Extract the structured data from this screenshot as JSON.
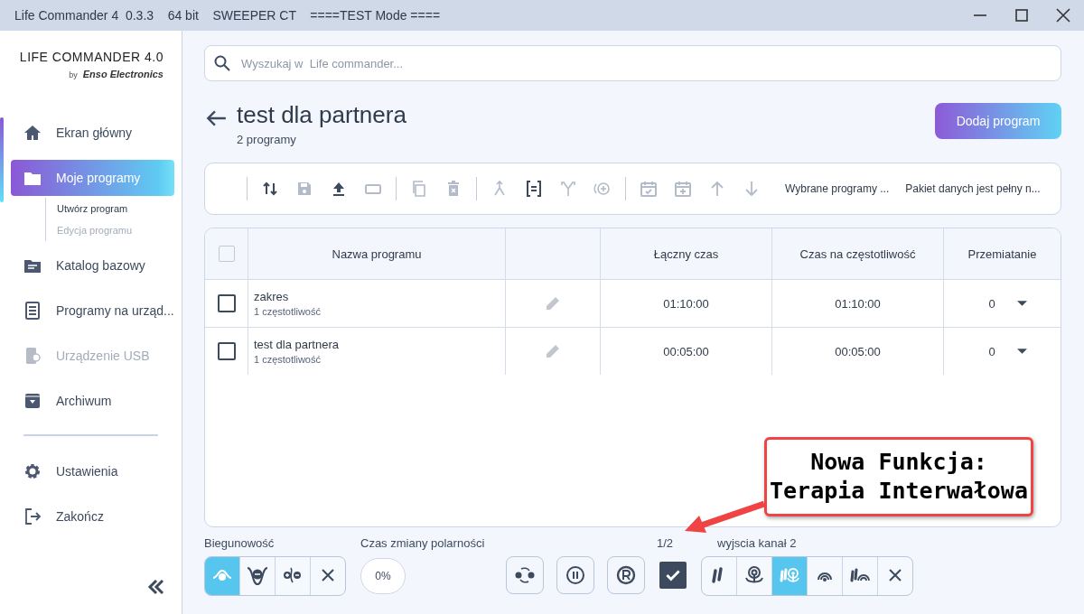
{
  "window": {
    "title": "Life Commander 4  0.3.3    64 bit    SWEEPER CT    ====TEST Mode ===="
  },
  "logo": {
    "title": "LIFE COMMANDER 4.0",
    "by": "by",
    "brand": "Enso Electronics"
  },
  "sidebar": {
    "items": [
      {
        "label": "Ekran główny",
        "selected": false,
        "disabled": false
      },
      {
        "label": "Moje programy",
        "selected": true,
        "disabled": false,
        "children": [
          {
            "label": "Utwórz program",
            "disabled": false
          },
          {
            "label": "Edycja programu",
            "disabled": true
          }
        ]
      },
      {
        "label": "Katalog bazowy",
        "selected": false,
        "disabled": false
      },
      {
        "label": "Programy na urząd...",
        "selected": false,
        "disabled": false
      },
      {
        "label": "Urządzenie USB",
        "selected": false,
        "disabled": true
      },
      {
        "label": "Archiwum",
        "selected": false,
        "disabled": false
      }
    ],
    "footer_items": [
      {
        "label": "Ustawienia"
      },
      {
        "label": "Zakończ"
      }
    ]
  },
  "search": {
    "placeholder": "Wyszukaj w  Life commander..."
  },
  "header": {
    "title": "test dla partnera",
    "subtitle": "2 programy",
    "button": "Dodaj program"
  },
  "toolbar": {
    "tools": [
      {
        "disabled": false
      },
      {
        "disabled": true
      },
      {
        "disabled": false
      },
      {
        "disabled": true
      },
      {
        "disabled": true
      },
      {
        "disabled": true
      },
      {
        "disabled": true
      },
      {
        "disabled": false
      },
      {
        "disabled": true
      },
      {
        "disabled": true
      },
      {
        "disabled": true
      },
      {
        "disabled": true
      },
      {
        "disabled": true
      },
      {
        "disabled": true
      }
    ],
    "status": [
      "Wybrane programy ...",
      "Pakiet danych jest pełny n..."
    ]
  },
  "table": {
    "columns": [
      "Nazwa programu",
      "Łączny czas",
      "Czas na częstotliwość",
      "Przemiatanie"
    ],
    "header_checked": false,
    "rows": [
      {
        "checked": false,
        "name": "zakres",
        "detail": "1 częstotliwość",
        "total": "01:10:00",
        "per_freq": "01:10:00",
        "sweep": "0"
      },
      {
        "checked": false,
        "name": "test dla partnera",
        "detail": "1 częstotliwość",
        "total": "00:05:00",
        "per_freq": "00:05:00",
        "sweep": "0"
      }
    ]
  },
  "bottom": {
    "polarity_label": "Biegunowość",
    "polarity": [
      {
        "selected": true
      },
      {
        "selected": false
      },
      {
        "selected": false
      },
      {
        "selected": false
      }
    ],
    "polarity_time_label": "Czas zmiany polarności",
    "polarity_time": "0%",
    "page": "1/2",
    "mode_label": "wyjscia kanał 2",
    "interval_checked": true,
    "modes": [
      {
        "selected": false
      },
      {
        "selected": false
      },
      {
        "selected": true
      },
      {
        "selected": false
      },
      {
        "selected": false
      },
      {
        "selected": false
      }
    ]
  },
  "callout": {
    "lines": [
      "Nowa Funkcja:",
      "Terapia Interwałowa"
    ]
  }
}
